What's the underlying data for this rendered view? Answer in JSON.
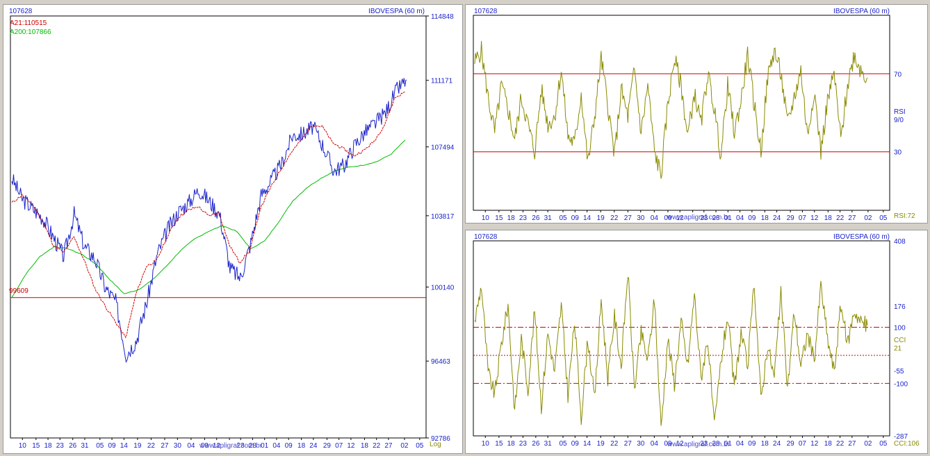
{
  "left": {
    "instrument_code": "107628",
    "title": "IBOVESPA (60 m)",
    "legend_a21": "A21:110515",
    "legend_a200": "A200:107866",
    "support_label": "99609",
    "scale_label": "Log",
    "watermark": "www.apligraf.com.br"
  },
  "rsi_panel": {
    "instrument_code": "107628",
    "title": "IBOVESPA (60 m)",
    "ind_name": "RSI",
    "ind_period": "9/0",
    "readout": "RSI:72",
    "watermark": "www.apligraf.com.br"
  },
  "cci_panel": {
    "instrument_code": "107628",
    "title": "IBOVESPA (60 m)",
    "ind_name": "CCI",
    "ind_period": "21",
    "readout": "CCI:106",
    "watermark": "www.apligraf.com.br"
  },
  "colors": {
    "price": "#1a22c8",
    "ma21": "#cc0000",
    "ma200": "#00bb00",
    "oscillator": "#8a8a00",
    "level_line": "#cc0000",
    "axis_text": "#1a22c8"
  },
  "chart_data": [
    {
      "type": "line",
      "title": "IBOVESPA (60 m)",
      "scale": "log",
      "ylim": [
        92786,
        114848
      ],
      "yticks": [
        114848,
        111171,
        107494,
        103817,
        100140,
        96463,
        92786
      ],
      "x_tick_labels": [
        "10",
        "15",
        "18",
        "23",
        "26",
        "31",
        "05",
        "09",
        "14",
        "19",
        "22",
        "27",
        "30",
        "04",
        "09",
        "12",
        "",
        "23",
        "28",
        "01",
        "04",
        "09",
        "18",
        "24",
        "29",
        "07",
        "12",
        "18",
        "22",
        "27",
        "02",
        "05"
      ],
      "horizontal_lines": [
        {
          "label": "99609",
          "value": 99609
        }
      ],
      "series": [
        {
          "name": "A21",
          "last": 110515,
          "values": [
            104500,
            104900,
            104400,
            103500,
            102300,
            101900,
            102700,
            101500,
            100100,
            99200,
            98400,
            97600,
            99800,
            101200,
            101500,
            102700,
            103700,
            104100,
            104300,
            103800,
            104000,
            102300,
            101400,
            102000,
            104200,
            105300,
            106300,
            107200,
            107900,
            108700,
            108600,
            107700,
            107400,
            107000,
            107300,
            107800,
            108700,
            110200,
            110515
          ]
        },
        {
          "name": "A200",
          "last": 107866,
          "values": [
            99609,
            100800,
            101700,
            102200,
            102100,
            101800,
            101300,
            100500,
            99800,
            100000,
            100500,
            101200,
            102000,
            102600,
            103000,
            103300,
            103000,
            102100,
            102500,
            103500,
            104600,
            105300,
            105800,
            106200,
            106400,
            106500,
            106700,
            107100,
            107866
          ]
        },
        {
          "name": "IBOVESPA",
          "last": 107628,
          "values": [
            105800,
            104700,
            104200,
            103700,
            102700,
            101700,
            103900,
            102200,
            101600,
            100100,
            99400,
            96800,
            97500,
            99400,
            101800,
            103100,
            104000,
            104500,
            105200,
            104600,
            103900,
            101100,
            100600,
            102400,
            104900,
            105700,
            106600,
            108100,
            108200,
            108600,
            107500,
            106200,
            106500,
            107600,
            108300,
            108800,
            109400,
            110600,
            111200
          ]
        }
      ]
    },
    {
      "type": "line",
      "title": "RSI 9/0",
      "ylim": [
        0,
        100
      ],
      "yticks": [
        70,
        30
      ],
      "last": 72,
      "x_tick_labels": [
        "10",
        "15",
        "18",
        "23",
        "26",
        "31",
        "05",
        "09",
        "14",
        "19",
        "22",
        "27",
        "30",
        "04",
        "09",
        "12",
        "",
        "23",
        "28",
        "01",
        "04",
        "09",
        "18",
        "24",
        "29",
        "07",
        "12",
        "18",
        "22",
        "27",
        "02",
        "05"
      ],
      "horizontal_lines": [
        70,
        30
      ],
      "values": [
        76,
        82,
        58,
        40,
        64,
        52,
        36,
        58,
        44,
        30,
        62,
        44,
        48,
        72,
        38,
        34,
        60,
        24,
        48,
        78,
        54,
        28,
        62,
        48,
        72,
        40,
        64,
        30,
        18,
        54,
        78,
        64,
        38,
        60,
        44,
        70,
        52,
        28,
        64,
        40,
        56,
        80,
        54,
        30,
        68,
        82,
        70,
        44,
        58,
        72,
        38,
        62,
        30,
        56,
        70,
        36,
        64,
        80,
        72,
        68
      ]
    },
    {
      "type": "line",
      "title": "CCI 21",
      "ylim": [
        -287,
        408
      ],
      "yticks": [
        408,
        176,
        100,
        -55,
        -100,
        -287
      ],
      "last": 106,
      "x_tick_labels": [
        "10",
        "15",
        "18",
        "23",
        "26",
        "31",
        "05",
        "09",
        "14",
        "19",
        "22",
        "27",
        "30",
        "04",
        "09",
        "12",
        "",
        "23",
        "28",
        "01",
        "04",
        "09",
        "18",
        "24",
        "29",
        "07",
        "12",
        "18",
        "22",
        "27",
        "02",
        "05"
      ],
      "horizontal_lines": [
        100,
        0,
        -100
      ],
      "values": [
        120,
        250,
        -60,
        -140,
        40,
        180,
        -200,
        60,
        -120,
        160,
        -180,
        80,
        -60,
        180,
        -140,
        120,
        -220,
        60,
        -160,
        200,
        -80,
        140,
        -40,
        300,
        -120,
        80,
        -20,
        200,
        -260,
        60,
        -100,
        120,
        -40,
        220,
        -80,
        60,
        -260,
        -20,
        140,
        -120,
        80,
        -40,
        260,
        -160,
        40,
        -80,
        220,
        -120,
        160,
        -40,
        80,
        -20,
        250,
        60,
        -60,
        180,
        40,
        160,
        120,
        106
      ]
    }
  ]
}
